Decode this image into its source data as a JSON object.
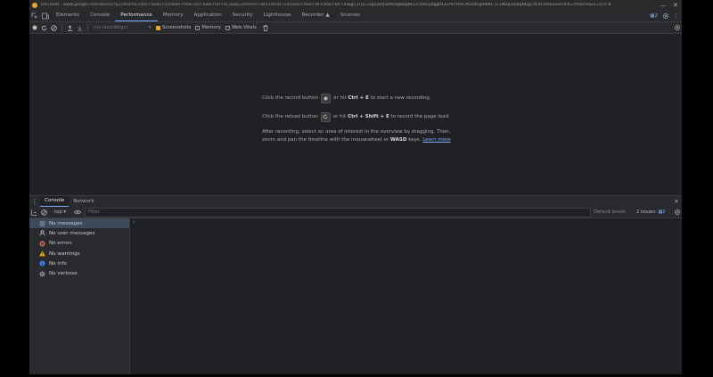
{
  "window": {
    "title": "DevTools - www.google.com/search?q=chrome+dev+tools+console+how+to+look+for+ki_&oq=chrome+dev+tools+console+how+to+look+for+ki&gs_lcrp=EgZjaHJvbWUqBwgBECEYoAEyBggAEEUYOTIHCAEQIRigAdIBCTE1NDg3ajBqN6gCALACAA&sourceid=chrome&ie=UTF-8"
  },
  "tabs": [
    "Elements",
    "Console",
    "Performance",
    "Memory",
    "Application",
    "Security",
    "Lighthouse",
    "Recorder ▲",
    "Sources"
  ],
  "active_tab": "Performance",
  "issues_count": "2",
  "perf_toolbar": {
    "profile_placeholder": "(no recordings)",
    "screenshots_label": "Screenshots",
    "memory_label": "Memory",
    "webvitals_label": "Web Vitals"
  },
  "landing": {
    "line1_prefix": "Click the record button",
    "line1_suffix": "or hit",
    "line1_keys": "Ctrl + E",
    "line1_end": "to start a new recording.",
    "line2_prefix": "Click the reload button",
    "line2_suffix": "or hit",
    "line2_keys": "Ctrl + Shift + E",
    "line2_end": "to record the page load.",
    "para_line1": "After recording, select an area of interest in the overview by dragging. Then,",
    "para_line2_prefix": "zoom and pan the timeline with the mousewheel or",
    "para_keys": "WASD",
    "para_line2_suffix": "keys.",
    "learn_more": "Learn more"
  },
  "drawer": {
    "tabs": [
      "Console",
      "Network"
    ],
    "active": "Console",
    "context": "top",
    "filter_placeholder": "Filter",
    "levels": "Default levels",
    "issues_label": "2 Issues:",
    "issues_count": "2"
  },
  "sidebar": {
    "items": [
      {
        "label": "No messages",
        "icon": "list-icon"
      },
      {
        "label": "No user messages",
        "icon": "user-icon"
      },
      {
        "label": "No errors",
        "icon": "error-icon"
      },
      {
        "label": "No warnings",
        "icon": "warning-icon"
      },
      {
        "label": "No info",
        "icon": "info-icon"
      },
      {
        "label": "No verbose",
        "icon": "verbose-icon"
      }
    ]
  },
  "console": {
    "prompt": "›"
  },
  "colors": {
    "accent": "#7cacf8",
    "checkbox": "#f5a623",
    "error": "#e46962",
    "warning": "#f5b400",
    "info": "#3b82f6"
  }
}
